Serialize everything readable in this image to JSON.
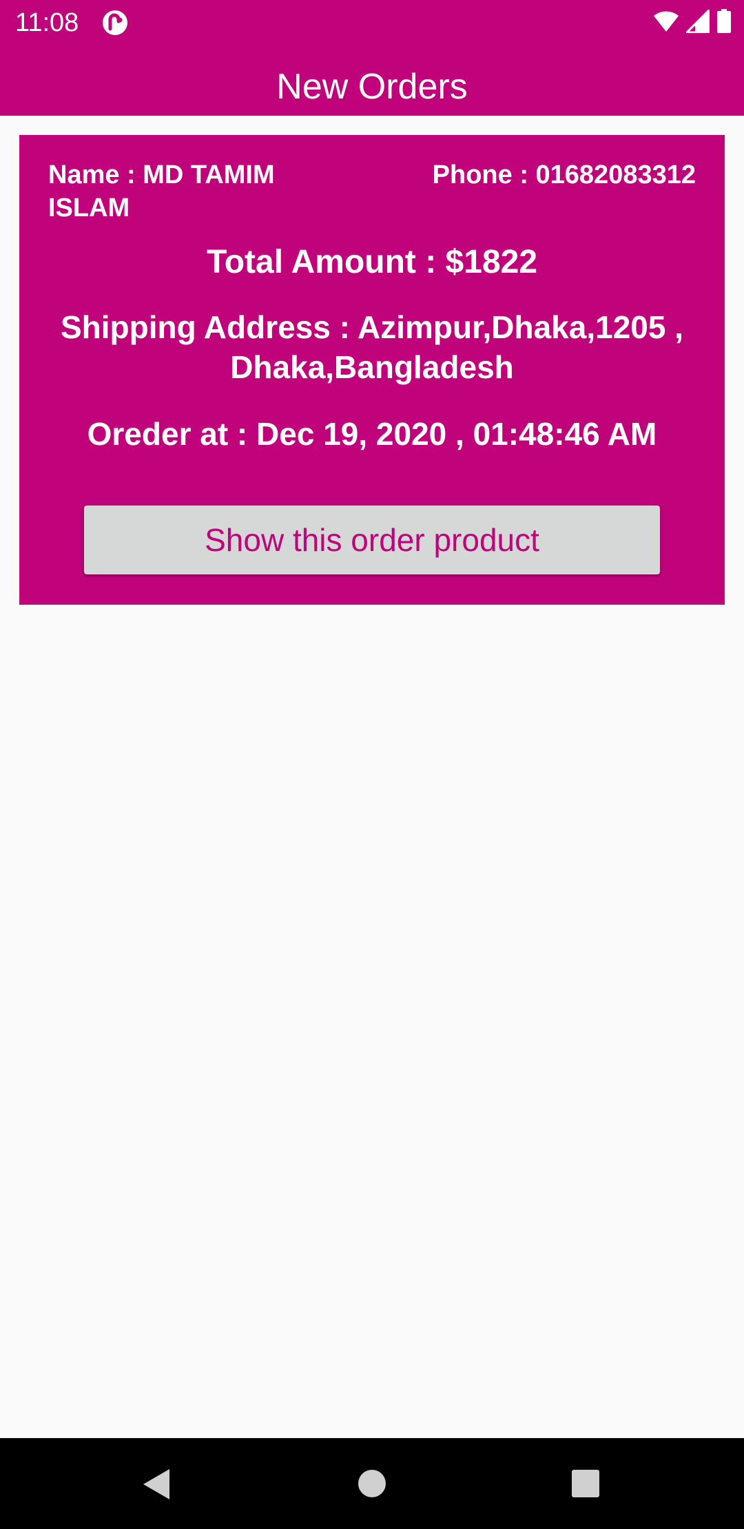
{
  "status_bar": {
    "time": "11:08",
    "app_icon": "app-notification-icon",
    "icons": [
      "wifi-icon",
      "signal-icon",
      "battery-icon"
    ]
  },
  "app_bar": {
    "title": "New Orders"
  },
  "order": {
    "name_text": "Name : MD TAMIM ISLAM",
    "phone_text": "Phone : 01682083312",
    "total_text": "Total Amount : $1822",
    "address_text": "Shipping Address : Azimpur,Dhaka,1205 , Dhaka,Bangladesh",
    "order_at_text": "Oreder at : Dec 19, 2020 , 01:48:46 AM",
    "button_label": "Show this order product"
  },
  "nav_bar": {
    "icons": [
      "back-icon",
      "home-icon",
      "recents-icon"
    ]
  },
  "colors": {
    "primary": "#c0037b",
    "button_bg": "#d6d7d7",
    "background": "#fafafa",
    "text_on_primary": "#ffffff"
  }
}
